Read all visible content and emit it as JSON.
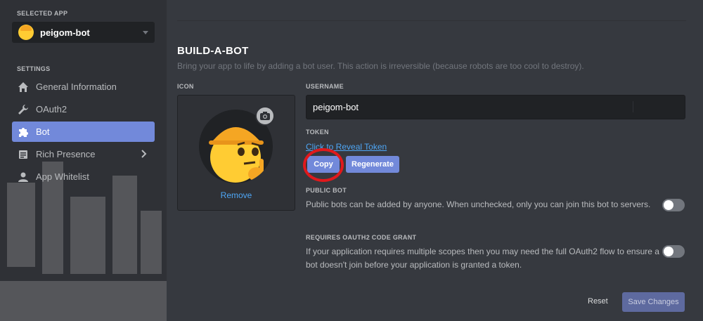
{
  "sidebar": {
    "selected_app_label": "SELECTED APP",
    "app_name": "peigom-bot",
    "settings_label": "SETTINGS",
    "items": [
      {
        "label": "General Information",
        "icon": "home-icon"
      },
      {
        "label": "OAuth2",
        "icon": "wrench-icon"
      },
      {
        "label": "Bot",
        "icon": "puzzle-icon",
        "active": true
      },
      {
        "label": "Rich Presence",
        "icon": "document-icon"
      },
      {
        "label": "App Whitelist",
        "icon": "user-icon"
      }
    ]
  },
  "main": {
    "title": "BUILD-A-BOT",
    "subtitle": "Bring your app to life by adding a bot user. This action is irreversible (because robots are too cool to destroy).",
    "icon_label": "ICON",
    "remove_label": "Remove",
    "username_label": "USERNAME",
    "username_value": "peigom-bot",
    "token_label": "TOKEN",
    "reveal_token": "Click to Reveal Token",
    "copy_button": "Copy",
    "regenerate_button": "Regenerate",
    "public_bot_label": "PUBLIC BOT",
    "public_bot_desc": "Public bots can be added by anyone. When unchecked, only you can join this bot to servers.",
    "oauth_label": "REQUIRES OAUTH2 CODE GRANT",
    "oauth_desc_line1": "If your application requires multiple scopes then you may need the full OAuth2 flow to ensure a",
    "oauth_desc_line2": "bot doesn't join before your application is granted a token.",
    "reset_button": "Reset",
    "save_button": "Save Changes"
  },
  "colors": {
    "accent": "#7289da",
    "link": "#4ea6f5",
    "highlight": "#e0191c",
    "background": "#36393f",
    "sidebar": "#2f3136"
  },
  "toggles": {
    "public_bot": false,
    "requires_oauth2_code_grant": false
  }
}
